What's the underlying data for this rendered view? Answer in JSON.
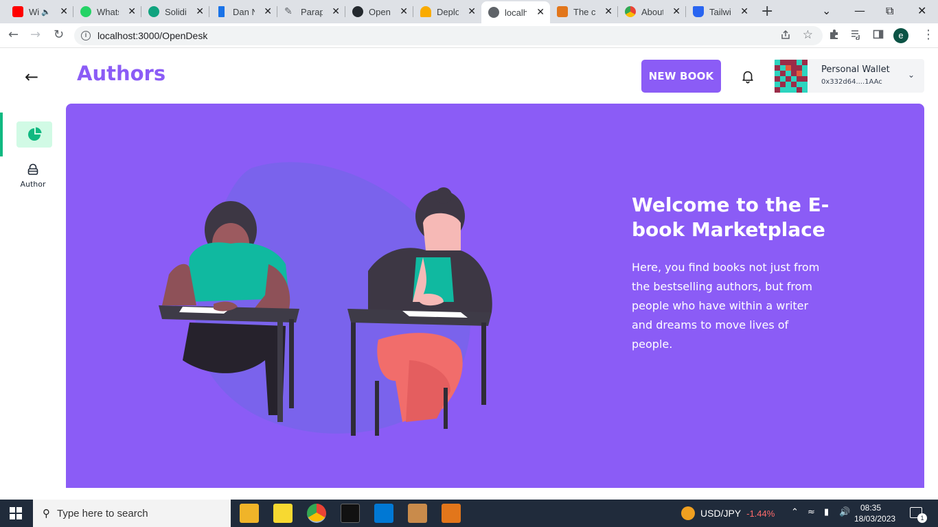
{
  "browser": {
    "tabs": [
      {
        "title": "Wi",
        "favicon": "youtube-icon",
        "color": "#ff0000",
        "muted": true
      },
      {
        "title": "Whats",
        "favicon": "whatsapp-icon",
        "color": "#25d366"
      },
      {
        "title": "Solidit",
        "favicon": "openai-icon",
        "color": "#10a37f"
      },
      {
        "title": "Dan N",
        "favicon": "bookmark-icon",
        "color": "#1a73e8"
      },
      {
        "title": "Paraph",
        "favicon": "quill-icon",
        "color": "#5f6368"
      },
      {
        "title": "OpenS",
        "favicon": "github-icon",
        "color": "#24292e"
      },
      {
        "title": "Deploy",
        "favicon": "warning-icon",
        "color": "#f9ab00"
      },
      {
        "title": "localh",
        "favicon": "globe-icon",
        "color": "#5f6368",
        "active": true
      },
      {
        "title": "The cr",
        "favicon": "metamask-icon",
        "color": "#e2761b"
      },
      {
        "title": "About",
        "favicon": "chrome-icon",
        "color": "#4285f4"
      },
      {
        "title": "Tailwin",
        "favicon": "css-icon",
        "color": "#2965f1"
      }
    ],
    "url": "localhost:3000/OpenDesk",
    "profile_initial": "e"
  },
  "app": {
    "page_title": "Authors",
    "new_book_label": "NEW BOOK",
    "wallet": {
      "name": "Personal Wallet",
      "address": "0x332d64....1AAc"
    },
    "sidebar": [
      {
        "label": "",
        "icon": "pie-chart-icon",
        "active": true
      },
      {
        "label": "Author",
        "icon": "lock-icon",
        "active": false
      }
    ],
    "hero": {
      "title": "Welcome to the E-book Marketplace",
      "text": "Here, you find books not just from the bestselling authors, but from people who have within a writer and dreams to move lives of people."
    },
    "colors": {
      "accent": "#8b5cf6",
      "sidebar_active": "#10b981"
    }
  },
  "taskbar": {
    "search_placeholder": "Type here to search",
    "ticker_symbol": "USD/JPY",
    "ticker_change": "-1.44%",
    "time": "08:35",
    "date": "18/03/2023",
    "notification_count": "1"
  }
}
